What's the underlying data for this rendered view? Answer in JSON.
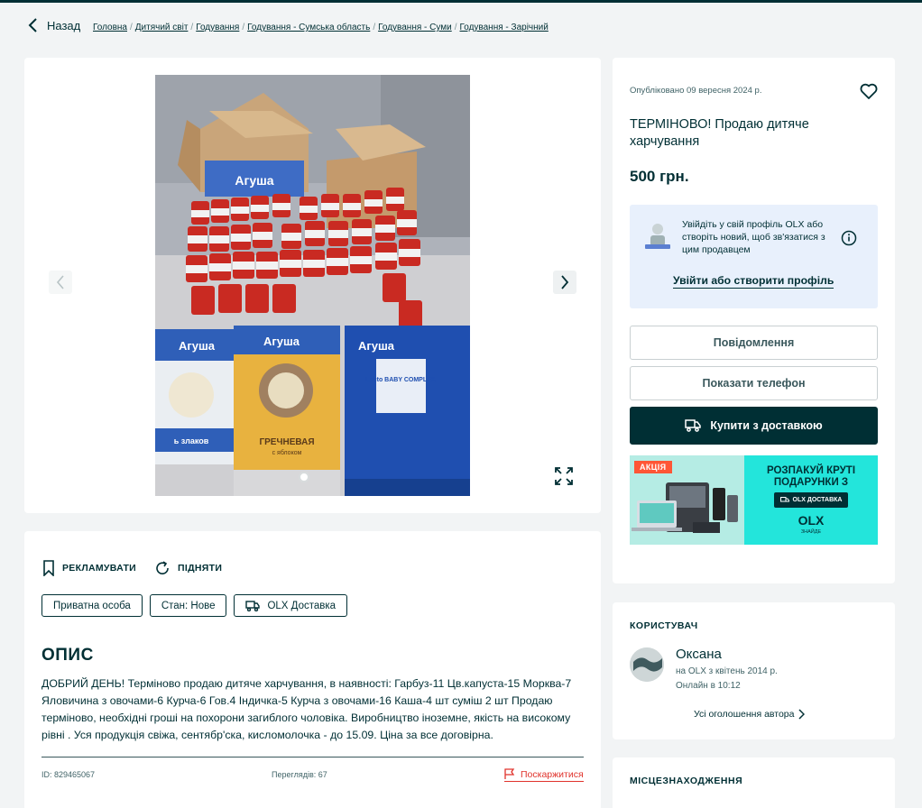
{
  "nav": {
    "back_label": "Назад",
    "breadcrumbs": [
      "Головна",
      "Дитячий світ",
      "Годування",
      "Годування - Сумська область",
      "Годування - Суми",
      "Годування - Зарічний"
    ]
  },
  "gallery": {
    "image_alt_texts": [
      "Агуша",
      "Агуша",
      "Агуша",
      "Агуша",
      "Lacto BABY COMPLEX"
    ],
    "cereal_labels": [
      "ь злаков",
      "ГРЕЧНЕВАЯ",
      "с яблоком"
    ],
    "current_photo": 1
  },
  "details": {
    "promote_label": "РЕКЛАМУВАТИ",
    "raise_label": "ПІДНЯТИ",
    "tags": [
      "Приватна особа",
      "Стан: Нове",
      "OLX Доставка"
    ],
    "description_title": "ОПИС",
    "description": "ДОБРИЙ ДЕНЬ! Терміново продаю дитяче харчування, в наявності: Гарбуз-11 Цв.капуста-15 Морква-7 Яловичина з овочами-6 Курча-6 Гов.4 Індичка-5 Курча з овочами-16 Каша-4 шт суміш 2 шт Продаю терміново, необхідні гроші на похорони загиблого чоловіка. Виробництво іноземне, якість на високому рівні . Уся продукція свіжа, сентябр'ска, кисломолочка - до 15.09. Ціна за все договірна.",
    "id_label": "ID: 829465067",
    "views_label": "Переглядів: 67",
    "report_label": "Поскаржитися"
  },
  "listing": {
    "published": "Опубліковано 09 вересня 2024 р.",
    "title": "ТЕРМІНОВО! Продаю дитяче харчування",
    "price": "500 грн.",
    "login_prompt": "Увійдіть у свій профіль OLX або створіть новий, щоб зв'язатися з цим продавцем",
    "login_link": "Увійти або створити профіль",
    "message_button": "Повідомлення",
    "phone_button": "Показати телефон",
    "buy_button": "Купити з доставкою"
  },
  "banner": {
    "badge": "АКЦІЯ",
    "headline": "РОЗПАКУЙ КРУТІ ПОДАРУНКИ З",
    "chip": "OLX ДОСТАВКА",
    "logo": "OLX",
    "sub": "ЗНАЙДЕ"
  },
  "user": {
    "section_title": "КОРИСТУВАЧ",
    "name": "Оксана",
    "since": "на OLX з квітень 2014 р.",
    "online": "Онлайн в 10:12",
    "all_ads": "Усі оголошення автора"
  },
  "location": {
    "section_title": "МІСЦЕЗНАХОДЖЕННЯ"
  },
  "colors": {
    "brand_dark": "#002f34",
    "report_red": "#e0332c",
    "login_bg": "#e8f0fc",
    "banner_teal": "#23e5db"
  }
}
